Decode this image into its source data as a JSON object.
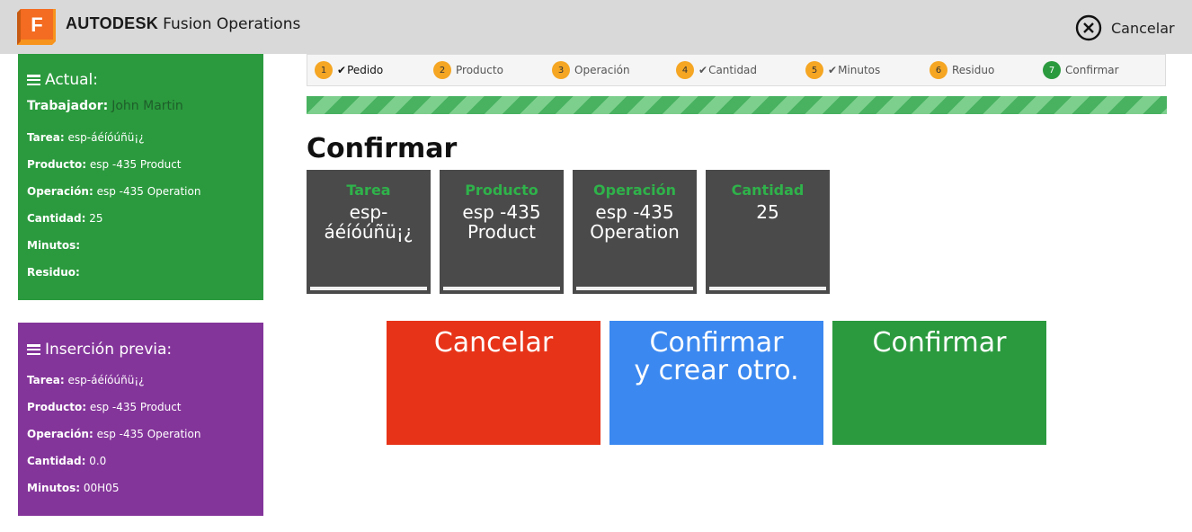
{
  "header": {
    "brand_bold": "AUTODESK",
    "brand_rest": "Fusion Operations",
    "logo_letter": "F",
    "logo_color": "#f36c21",
    "cancel_label": "Cancelar"
  },
  "actual": {
    "title": "Actual:",
    "worker_label": "Trabajador:",
    "worker_value": "John Martin",
    "rows": [
      {
        "label": "Tarea",
        "value": " esp-áéíóúñü¡¿"
      },
      {
        "label": "Producto",
        "value": " esp -435 Product"
      },
      {
        "label": "Operación",
        "value": " esp -435 Operation"
      },
      {
        "label": "Cantidad",
        "value": " 25"
      },
      {
        "label": "Minutos",
        "value": ""
      },
      {
        "label": "Residuo",
        "value": ""
      }
    ]
  },
  "previa": {
    "title": "Inserción previa:",
    "rows": [
      {
        "label": "Tarea",
        "value": " esp-áéíóúñü¡¿"
      },
      {
        "label": "Producto",
        "value": " esp -435 Product"
      },
      {
        "label": "Operación",
        "value": " esp -435 Operation"
      },
      {
        "label": "Cantidad",
        "value": " 0.0"
      },
      {
        "label": "Minutos",
        "value": " 00H05"
      }
    ]
  },
  "steps": [
    {
      "num": "1",
      "label": "Pedido",
      "checked": true
    },
    {
      "num": "2",
      "label": "Producto",
      "checked": false
    },
    {
      "num": "3",
      "label": "Operación",
      "checked": false
    },
    {
      "num": "4",
      "label": "Cantidad",
      "checked": true
    },
    {
      "num": "5",
      "label": "Minutos",
      "checked": true
    },
    {
      "num": "6",
      "label": "Residuo",
      "checked": false
    },
    {
      "num": "7",
      "label": "Confirmar",
      "checked": false,
      "current": true
    }
  ],
  "page_title": "Confirmar",
  "tiles": [
    {
      "label": "Tarea",
      "value_line1": "esp-",
      "value_line2": "áéíóúñü¡¿"
    },
    {
      "label": "Producto",
      "value_line1": "esp -435",
      "value_line2": "Product"
    },
    {
      "label": "Operación",
      "value_line1": "esp -435",
      "value_line2": "Operation"
    },
    {
      "label": "Cantidad",
      "value_line1": "25",
      "value_line2": ""
    }
  ],
  "buttons": {
    "cancel": "Cancelar",
    "confirm_new_line1": "Confirmar",
    "confirm_new_line2": "y crear otro.",
    "confirm": "Confirmar"
  },
  "colors": {
    "green": "#2b9a3e",
    "purple": "#84359a",
    "red": "#e73419",
    "blue": "#3b88f0",
    "step_pending": "#f5a623",
    "tile_bg": "#4a4a4a"
  }
}
